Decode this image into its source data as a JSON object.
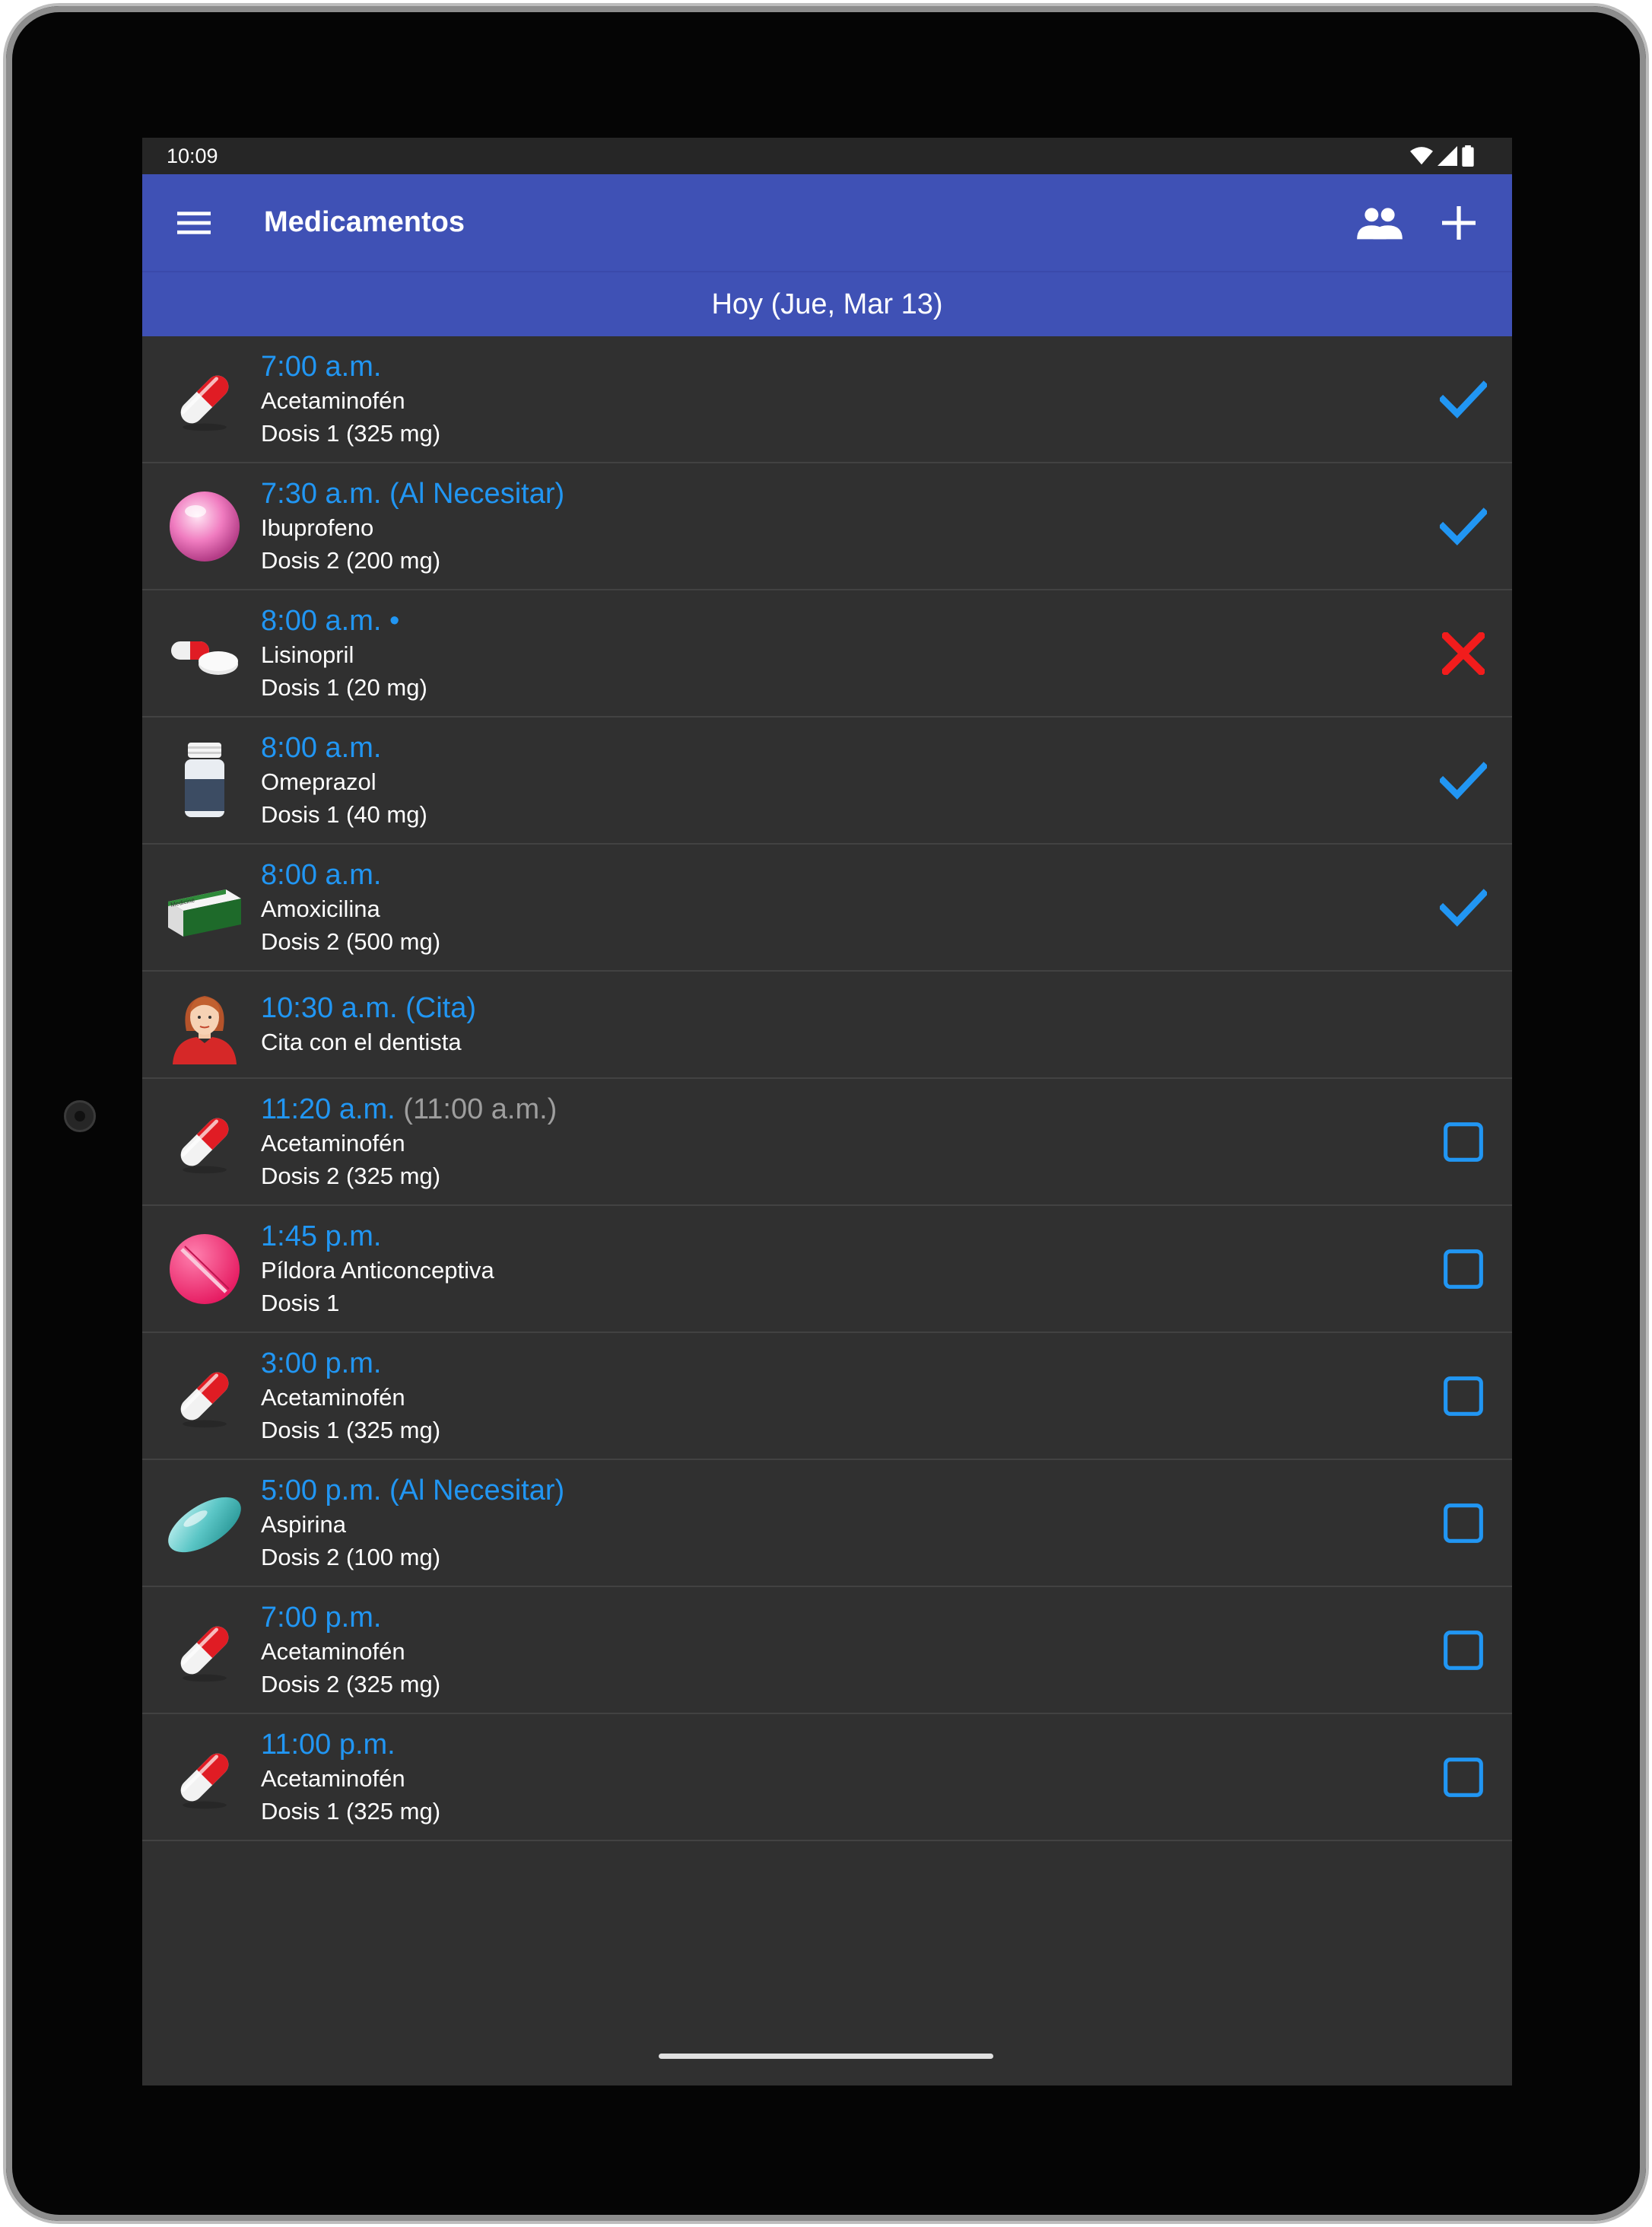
{
  "status_bar": {
    "time": "10:09"
  },
  "app_bar": {
    "title": "Medicamentos",
    "icons": [
      "menu-icon",
      "people-icon",
      "add-icon"
    ]
  },
  "date_header": "Hoy (Jue, Mar 13)",
  "colors": {
    "primary": "#3f51b5",
    "accent": "#2196f3",
    "background": "#303030",
    "missed": "#f21c1c"
  },
  "items": [
    {
      "time": "7:00 a.m.",
      "original_time": "",
      "name": "Acetaminofén",
      "dose": "Dosis 1 (325 mg)",
      "icon": "capsule-red-white",
      "status": "taken"
    },
    {
      "time": "7:30 a.m. (Al Necesitar)",
      "original_time": "",
      "name": "Ibuprofeno",
      "dose": "Dosis 2 (200 mg)",
      "icon": "pink-round-pill",
      "status": "taken"
    },
    {
      "time": "8:00 a.m. •",
      "original_time": "",
      "name": "Lisinopril",
      "dose": "Dosis 1 (20 mg)",
      "icon": "capsule-and-tablet",
      "status": "missed"
    },
    {
      "time": "8:00 a.m.",
      "original_time": "",
      "name": "Omeprazol",
      "dose": "Dosis 1 (40 mg)",
      "icon": "pill-bottle",
      "status": "taken"
    },
    {
      "time": "8:00 a.m.",
      "original_time": "",
      "name": "Amoxicilina",
      "dose": "Dosis 2 (500 mg)",
      "icon": "medicine-box",
      "status": "taken"
    },
    {
      "time": "10:30 a.m. (Cita)",
      "original_time": "",
      "name": "Cita con el dentista",
      "dose": "",
      "icon": "person-avatar",
      "status": "none"
    },
    {
      "time": "11:20 a.m.",
      "original_time": "(11:00 a.m.)",
      "name": "Acetaminofén",
      "dose": "Dosis 2 (325 mg)",
      "icon": "capsule-red-white",
      "status": "pending"
    },
    {
      "time": "1:45 p.m.",
      "original_time": "",
      "name": "Píldora Anticonceptiva",
      "dose": "Dosis 1",
      "icon": "pink-scored-tablet",
      "status": "pending"
    },
    {
      "time": "3:00 p.m.",
      "original_time": "",
      "name": "Acetaminofén",
      "dose": "Dosis 1 (325 mg)",
      "icon": "capsule-red-white",
      "status": "pending"
    },
    {
      "time": "5:00 p.m. (Al Necesitar)",
      "original_time": "",
      "name": "Aspirina",
      "dose": "Dosis 2 (100 mg)",
      "icon": "teal-softgel",
      "status": "pending"
    },
    {
      "time": "7:00 p.m.",
      "original_time": "",
      "name": "Acetaminofén",
      "dose": "Dosis 2 (325 mg)",
      "icon": "capsule-red-white",
      "status": "pending"
    },
    {
      "time": "11:00 p.m.",
      "original_time": "",
      "name": "Acetaminofén",
      "dose": "Dosis 1 (325 mg)",
      "icon": "capsule-red-white",
      "status": "pending"
    }
  ]
}
